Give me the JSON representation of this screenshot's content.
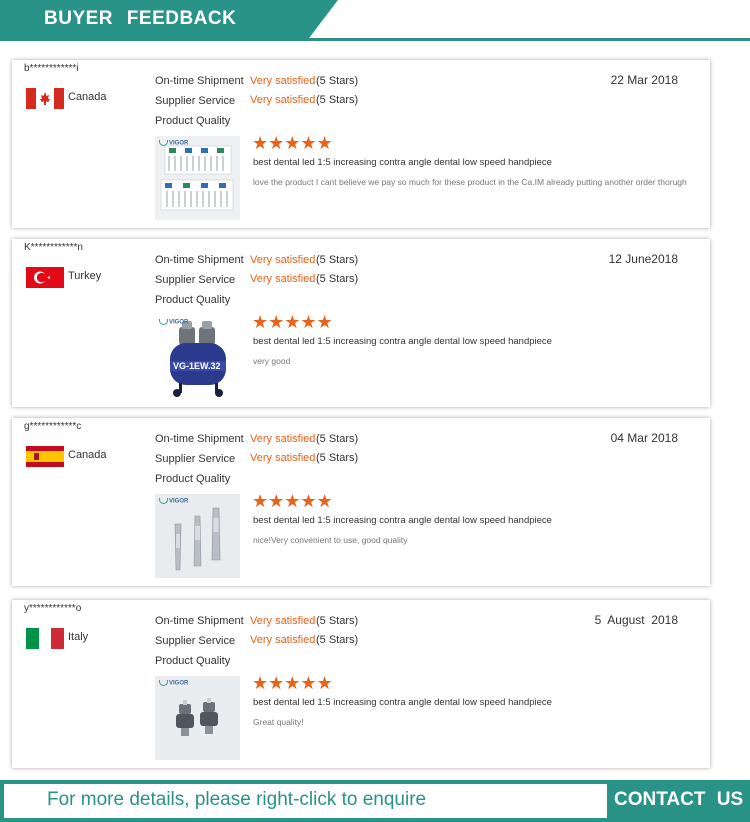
{
  "header": {
    "title": "BUYER FEEDBACK"
  },
  "ratings_labels": {
    "on_time": "On-time Shipment",
    "supplier": "Supplier Service",
    "quality": "Product Quality"
  },
  "reviews": [
    {
      "user": "b************i",
      "country": "Canada",
      "flag": "canada-flag",
      "on_time_value": "Very satisfied",
      "on_time_stars": "(5 Stars)",
      "supplier_value": "Very satisfied",
      "supplier_stars": "(5 Stars)",
      "date": "22 Mar 2018",
      "stars": "★★★★★",
      "product": "best dental led 1:5 increasing contra angle dental low speed handpiece",
      "comment": "love the product I cant believe we pay so much for these product in the Ca.IM already putting another order thorugh",
      "image": "dental-bur-kits-image"
    },
    {
      "user": "K************n",
      "country": "Turkey",
      "flag": "turkey-flag",
      "on_time_value": "Very satisfied",
      "on_time_stars": "(5 Stars)",
      "supplier_value": "Very satisfied",
      "supplier_stars": "(5 Stars)",
      "date": "12 June2018",
      "stars": "★★★★★",
      "product": "best dental led 1:5 increasing contra angle dental low speed handpiece",
      "comment": "very good",
      "image": "air-compressor-image",
      "image_text": "VG-1EW.32"
    },
    {
      "user": "g************c",
      "country": "Canada",
      "flag": "spain-flag",
      "on_time_value": "Very satisfied",
      "on_time_stars": "(5 Stars)",
      "supplier_value": "Very satisfied",
      "supplier_stars": "(5 Stars)",
      "date": "04 Mar 2018",
      "stars": "★★★★★",
      "product": "best dental led 1:5 increasing contra angle dental low speed handpiece",
      "comment": "nice!Very convenient to use, good quality",
      "image": "handpiece-set-image"
    },
    {
      "user": "y************o",
      "country": "Italy",
      "flag": "italy-flag",
      "on_time_value": "Very satisfied",
      "on_time_stars": "(5 Stars)",
      "supplier_value": "Very satisfied",
      "supplier_stars": "(5 Stars)",
      "date": "5  August  2018",
      "stars": "★★★★★",
      "product": "best dental led 1:5 increasing contra angle dental low speed handpiece",
      "comment": "Great quality!",
      "image": "cartridges-image"
    }
  ],
  "brand_logo": "VIGOR",
  "footer": {
    "more_text": "For more details, please right-click to enquire",
    "contact_label": "CONTACT US"
  },
  "colors": {
    "teal": "#2a9388",
    "orange": "#e8631a"
  }
}
